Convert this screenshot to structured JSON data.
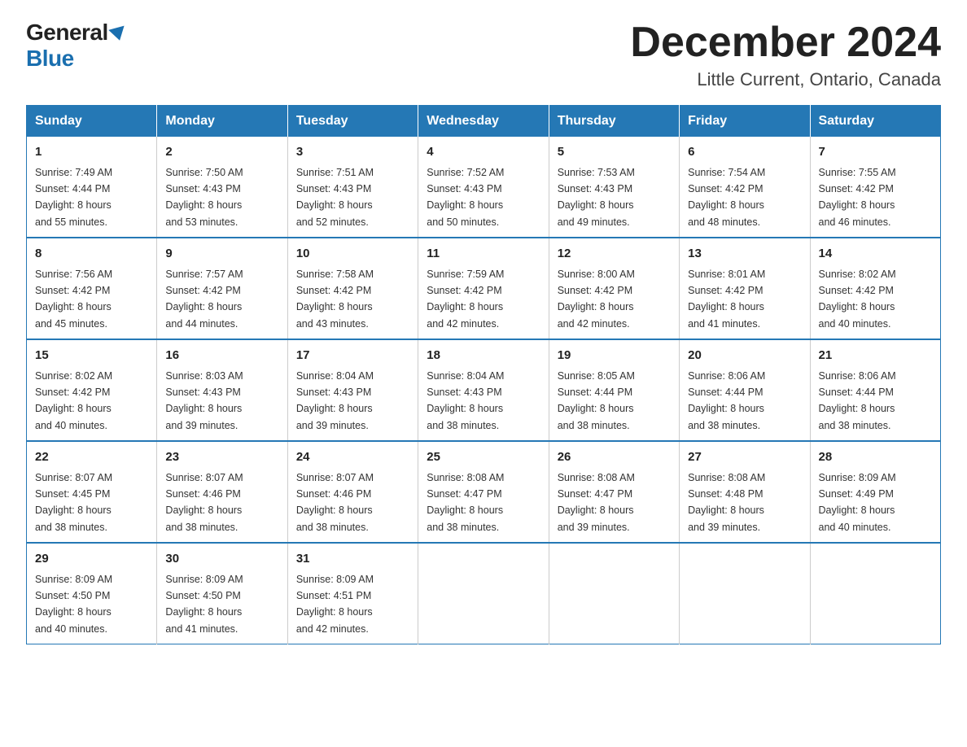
{
  "logo": {
    "general": "General",
    "blue": "Blue"
  },
  "title": {
    "month": "December 2024",
    "location": "Little Current, Ontario, Canada"
  },
  "weekdays": [
    "Sunday",
    "Monday",
    "Tuesday",
    "Wednesday",
    "Thursday",
    "Friday",
    "Saturday"
  ],
  "weeks": [
    [
      {
        "day": "1",
        "sunrise": "7:49 AM",
        "sunset": "4:44 PM",
        "daylight": "8 hours and 55 minutes."
      },
      {
        "day": "2",
        "sunrise": "7:50 AM",
        "sunset": "4:43 PM",
        "daylight": "8 hours and 53 minutes."
      },
      {
        "day": "3",
        "sunrise": "7:51 AM",
        "sunset": "4:43 PM",
        "daylight": "8 hours and 52 minutes."
      },
      {
        "day": "4",
        "sunrise": "7:52 AM",
        "sunset": "4:43 PM",
        "daylight": "8 hours and 50 minutes."
      },
      {
        "day": "5",
        "sunrise": "7:53 AM",
        "sunset": "4:43 PM",
        "daylight": "8 hours and 49 minutes."
      },
      {
        "day": "6",
        "sunrise": "7:54 AM",
        "sunset": "4:42 PM",
        "daylight": "8 hours and 48 minutes."
      },
      {
        "day": "7",
        "sunrise": "7:55 AM",
        "sunset": "4:42 PM",
        "daylight": "8 hours and 46 minutes."
      }
    ],
    [
      {
        "day": "8",
        "sunrise": "7:56 AM",
        "sunset": "4:42 PM",
        "daylight": "8 hours and 45 minutes."
      },
      {
        "day": "9",
        "sunrise": "7:57 AM",
        "sunset": "4:42 PM",
        "daylight": "8 hours and 44 minutes."
      },
      {
        "day": "10",
        "sunrise": "7:58 AM",
        "sunset": "4:42 PM",
        "daylight": "8 hours and 43 minutes."
      },
      {
        "day": "11",
        "sunrise": "7:59 AM",
        "sunset": "4:42 PM",
        "daylight": "8 hours and 42 minutes."
      },
      {
        "day": "12",
        "sunrise": "8:00 AM",
        "sunset": "4:42 PM",
        "daylight": "8 hours and 42 minutes."
      },
      {
        "day": "13",
        "sunrise": "8:01 AM",
        "sunset": "4:42 PM",
        "daylight": "8 hours and 41 minutes."
      },
      {
        "day": "14",
        "sunrise": "8:02 AM",
        "sunset": "4:42 PM",
        "daylight": "8 hours and 40 minutes."
      }
    ],
    [
      {
        "day": "15",
        "sunrise": "8:02 AM",
        "sunset": "4:42 PM",
        "daylight": "8 hours and 40 minutes."
      },
      {
        "day": "16",
        "sunrise": "8:03 AM",
        "sunset": "4:43 PM",
        "daylight": "8 hours and 39 minutes."
      },
      {
        "day": "17",
        "sunrise": "8:04 AM",
        "sunset": "4:43 PM",
        "daylight": "8 hours and 39 minutes."
      },
      {
        "day": "18",
        "sunrise": "8:04 AM",
        "sunset": "4:43 PM",
        "daylight": "8 hours and 38 minutes."
      },
      {
        "day": "19",
        "sunrise": "8:05 AM",
        "sunset": "4:44 PM",
        "daylight": "8 hours and 38 minutes."
      },
      {
        "day": "20",
        "sunrise": "8:06 AM",
        "sunset": "4:44 PM",
        "daylight": "8 hours and 38 minutes."
      },
      {
        "day": "21",
        "sunrise": "8:06 AM",
        "sunset": "4:44 PM",
        "daylight": "8 hours and 38 minutes."
      }
    ],
    [
      {
        "day": "22",
        "sunrise": "8:07 AM",
        "sunset": "4:45 PM",
        "daylight": "8 hours and 38 minutes."
      },
      {
        "day": "23",
        "sunrise": "8:07 AM",
        "sunset": "4:46 PM",
        "daylight": "8 hours and 38 minutes."
      },
      {
        "day": "24",
        "sunrise": "8:07 AM",
        "sunset": "4:46 PM",
        "daylight": "8 hours and 38 minutes."
      },
      {
        "day": "25",
        "sunrise": "8:08 AM",
        "sunset": "4:47 PM",
        "daylight": "8 hours and 38 minutes."
      },
      {
        "day": "26",
        "sunrise": "8:08 AM",
        "sunset": "4:47 PM",
        "daylight": "8 hours and 39 minutes."
      },
      {
        "day": "27",
        "sunrise": "8:08 AM",
        "sunset": "4:48 PM",
        "daylight": "8 hours and 39 minutes."
      },
      {
        "day": "28",
        "sunrise": "8:09 AM",
        "sunset": "4:49 PM",
        "daylight": "8 hours and 40 minutes."
      }
    ],
    [
      {
        "day": "29",
        "sunrise": "8:09 AM",
        "sunset": "4:50 PM",
        "daylight": "8 hours and 40 minutes."
      },
      {
        "day": "30",
        "sunrise": "8:09 AM",
        "sunset": "4:50 PM",
        "daylight": "8 hours and 41 minutes."
      },
      {
        "day": "31",
        "sunrise": "8:09 AM",
        "sunset": "4:51 PM",
        "daylight": "8 hours and 42 minutes."
      },
      null,
      null,
      null,
      null
    ]
  ],
  "labels": {
    "sunrise": "Sunrise:",
    "sunset": "Sunset:",
    "daylight": "Daylight:"
  }
}
